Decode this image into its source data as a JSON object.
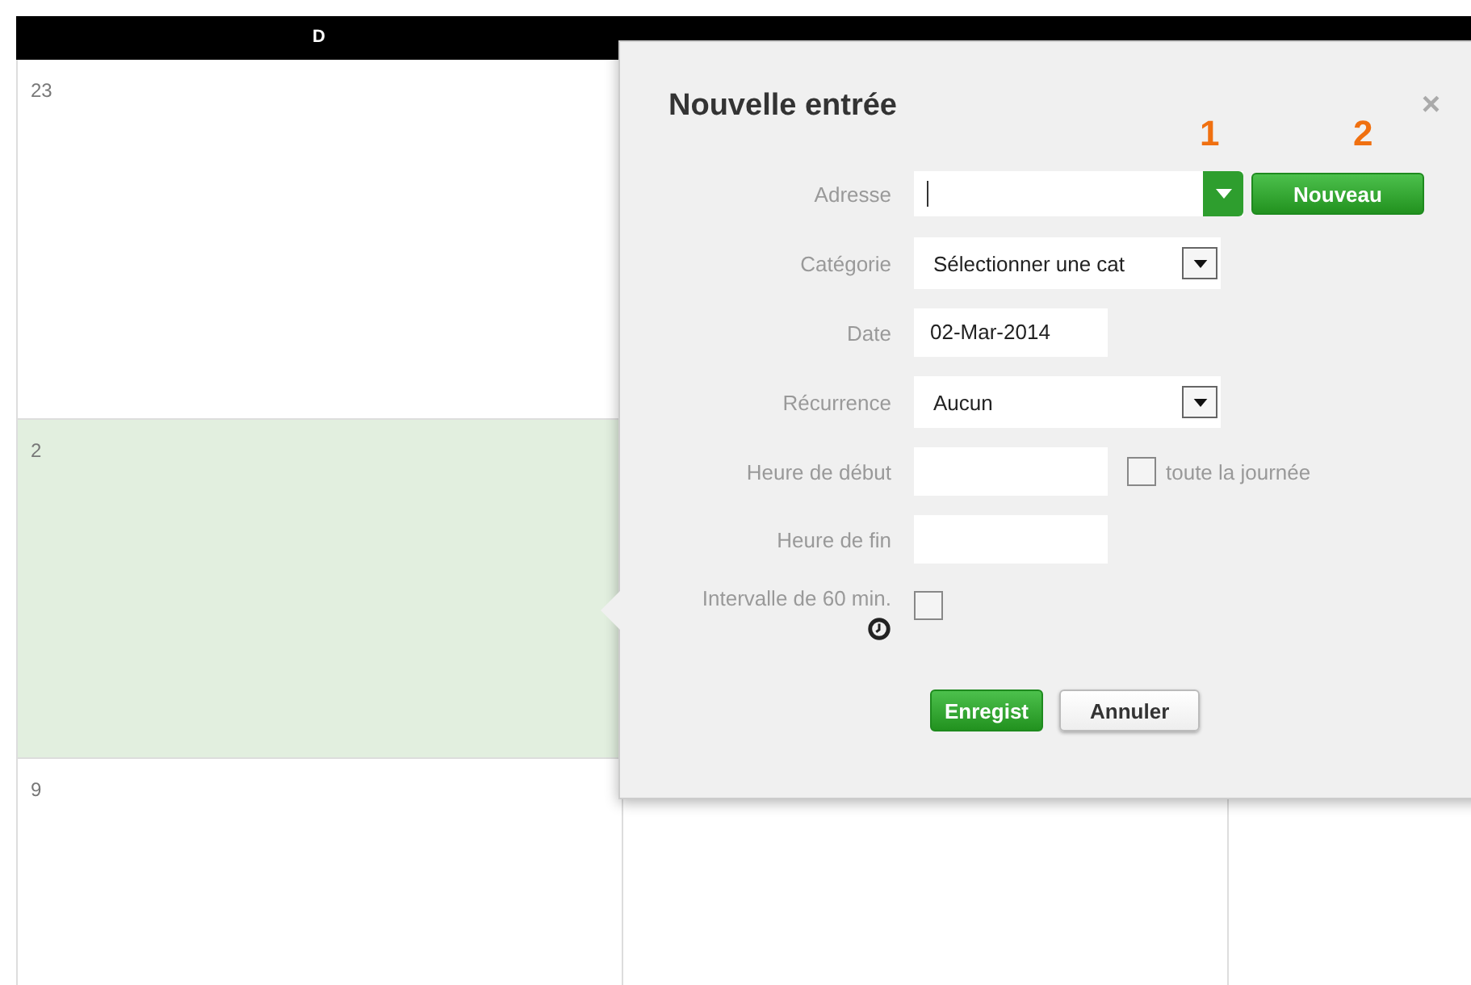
{
  "calendar": {
    "headers": [
      "D"
    ],
    "weeks": [
      {
        "cells": [
          {
            "day": "23",
            "selected": false
          }
        ]
      },
      {
        "cells": [
          {
            "day": "2",
            "selected": true
          }
        ]
      },
      {
        "cells": [
          {
            "day": "9",
            "selected": false
          }
        ]
      }
    ]
  },
  "dialog": {
    "title": "Nouvelle entrée",
    "close": "×",
    "rows": [
      {
        "kind": "combo",
        "label": "Adresse",
        "button": "Nouveau"
      },
      {
        "kind": "select",
        "label": "Catégorie",
        "value": "Sélectionner une cat"
      },
      {
        "kind": "text",
        "label": "Date",
        "value": "02-Mar-2014"
      },
      {
        "kind": "select",
        "label": "Récurrence",
        "value": "Aucun"
      },
      {
        "kind": "time",
        "label": "Heure de début",
        "option": {
          "label": "toute la journée",
          "checked": false
        }
      },
      {
        "kind": "time",
        "label": "Heure de fin"
      },
      {
        "kind": "checkbox",
        "label": "Intervalle de 60 min.",
        "checked": false
      }
    ],
    "buttons": [
      {
        "kind": "primary",
        "label": "Enregist"
      },
      {
        "kind": "secondary",
        "label": "Annuler"
      }
    ]
  },
  "annotations": [
    "1",
    "2"
  ]
}
